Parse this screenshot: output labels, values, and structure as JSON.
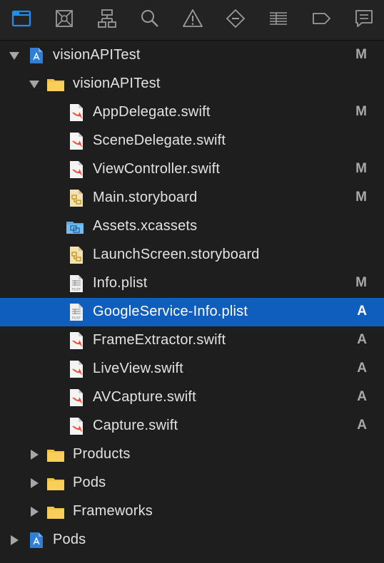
{
  "toolbar": {
    "icons": [
      {
        "name": "project-navigator-icon",
        "active": true
      },
      {
        "name": "source-control-navigator-icon"
      },
      {
        "name": "symbol-navigator-icon"
      },
      {
        "name": "find-navigator-icon"
      },
      {
        "name": "issue-navigator-icon"
      },
      {
        "name": "test-navigator-icon"
      },
      {
        "name": "debug-navigator-icon"
      },
      {
        "name": "breakpoint-navigator-icon"
      },
      {
        "name": "report-navigator-icon"
      }
    ],
    "active_color": "#1f8ef1",
    "inactive_color": "#9a9a9a"
  },
  "tree": {
    "rows": [
      {
        "label": "visionAPITest",
        "status": "M",
        "icon": "xcodeproj-icon",
        "disclosure": "expanded"
      },
      {
        "label": "visionAPITest",
        "status": "",
        "icon": "folder-icon",
        "disclosure": "expanded"
      },
      {
        "label": "AppDelegate.swift",
        "status": "M",
        "icon": "swift-file-icon"
      },
      {
        "label": "SceneDelegate.swift",
        "status": "",
        "icon": "swift-file-icon"
      },
      {
        "label": "ViewController.swift",
        "status": "M",
        "icon": "swift-file-icon"
      },
      {
        "label": "Main.storyboard",
        "status": "M",
        "icon": "storyboard-file-icon"
      },
      {
        "label": "Assets.xcassets",
        "status": "",
        "icon": "asset-catalog-icon"
      },
      {
        "label": "LaunchScreen.storyboard",
        "status": "",
        "icon": "storyboard-file-icon"
      },
      {
        "label": "Info.plist",
        "status": "M",
        "icon": "plist-file-icon",
        "icon_text": "PLIST"
      },
      {
        "label": "GoogleService-Info.plist",
        "status": "A",
        "icon": "plist-file-icon",
        "icon_text": "PLIST",
        "selected": true
      },
      {
        "label": "FrameExtractor.swift",
        "status": "A",
        "icon": "swift-file-icon"
      },
      {
        "label": "LiveView.swift",
        "status": "A",
        "icon": "swift-file-icon"
      },
      {
        "label": "AVCapture.swift",
        "status": "A",
        "icon": "swift-file-icon"
      },
      {
        "label": "Capture.swift",
        "status": "A",
        "icon": "swift-file-icon"
      },
      {
        "label": "Products",
        "status": "",
        "icon": "folder-icon",
        "disclosure": "collapsed"
      },
      {
        "label": "Pods",
        "status": "",
        "icon": "folder-icon",
        "disclosure": "collapsed"
      },
      {
        "label": "Frameworks",
        "status": "",
        "icon": "folder-icon",
        "disclosure": "collapsed"
      },
      {
        "label": "Pods",
        "status": "",
        "icon": "xcodeproj-icon",
        "disclosure": "collapsed"
      }
    ]
  },
  "colors": {
    "selection": "#0f5dbd",
    "folder": "#f5c342",
    "swift": "#f05138"
  }
}
